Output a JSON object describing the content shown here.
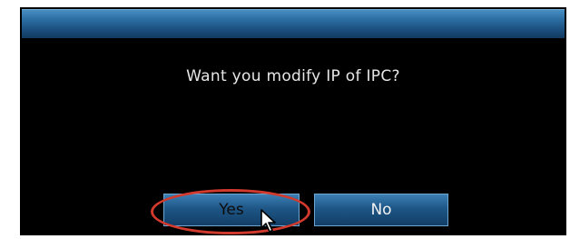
{
  "dialog": {
    "message": "Want you modify IP of IPC?",
    "buttons": {
      "yes_label": "Yes",
      "no_label": "No"
    }
  },
  "annotation": {
    "highlight_color": "#d33a2e",
    "highlighted_button": "Yes",
    "pointer_icon": "mouse-cursor-icon"
  },
  "colors": {
    "title_bar": "#2c6ea3",
    "button_fill": "#1e5686",
    "button_border": "#6fa6cf",
    "background": "#000000"
  }
}
